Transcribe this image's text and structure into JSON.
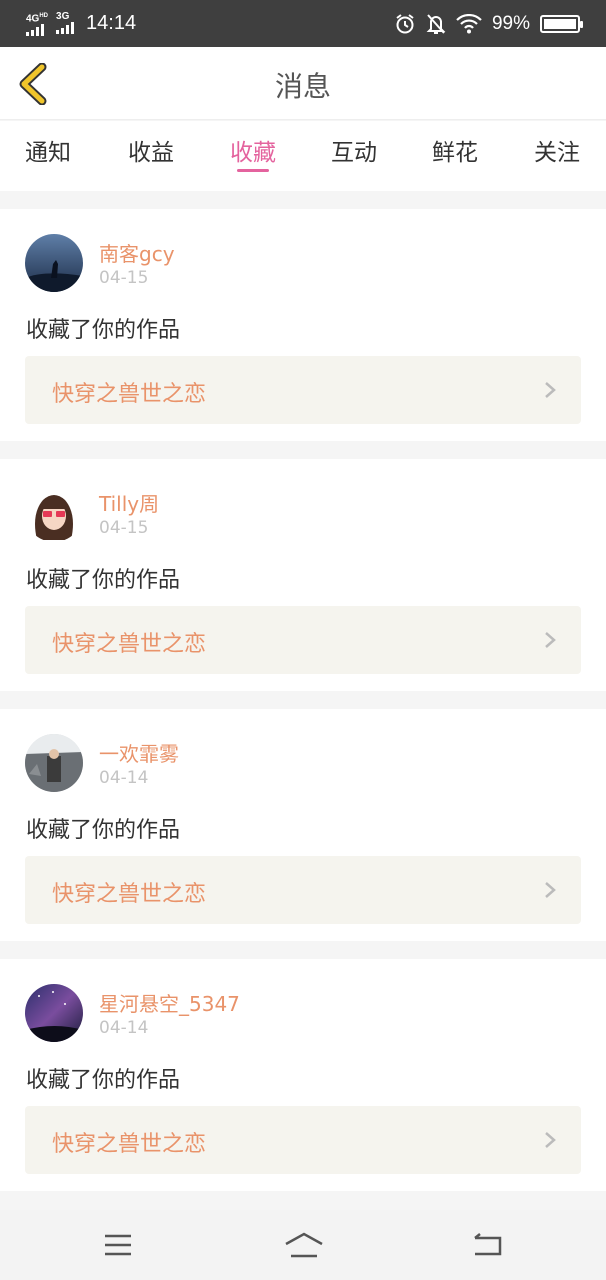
{
  "status_bar": {
    "net1": "4G",
    "net1_sup": "HD",
    "net2": "3G",
    "time": "14:14",
    "battery_text": "99%",
    "battery_level": 0.99
  },
  "header": {
    "title": "消息"
  },
  "tabs": [
    {
      "label": "通知"
    },
    {
      "label": "收益"
    },
    {
      "label": "收藏",
      "active": true
    },
    {
      "label": "互动"
    },
    {
      "label": "鲜花"
    },
    {
      "label": "关注"
    }
  ],
  "messages": [
    {
      "user": "南客gcy",
      "date": "04-15",
      "action": "收藏了你的作品",
      "work": "快穿之兽世之恋"
    },
    {
      "user": "Tilly周",
      "date": "04-15",
      "action": "收藏了你的作品",
      "work": "快穿之兽世之恋"
    },
    {
      "user": "一欢霏雾",
      "date": "04-14",
      "action": "收藏了你的作品",
      "work": "快穿之兽世之恋"
    },
    {
      "user": "星河悬空_5347",
      "date": "04-14",
      "action": "收藏了你的作品",
      "work": "快穿之兽世之恋"
    }
  ],
  "colors": {
    "accent": "#e4639e",
    "name": "#e9936a",
    "back_arrow": "#f0c52b",
    "work_bg": "#f5f4ee"
  },
  "icons": [
    "back-arrow-icon",
    "alarm-icon",
    "mute-bell-icon",
    "wifi-icon",
    "battery-icon",
    "chevron-right-icon",
    "menu-icon",
    "home-icon",
    "return-icon"
  ]
}
